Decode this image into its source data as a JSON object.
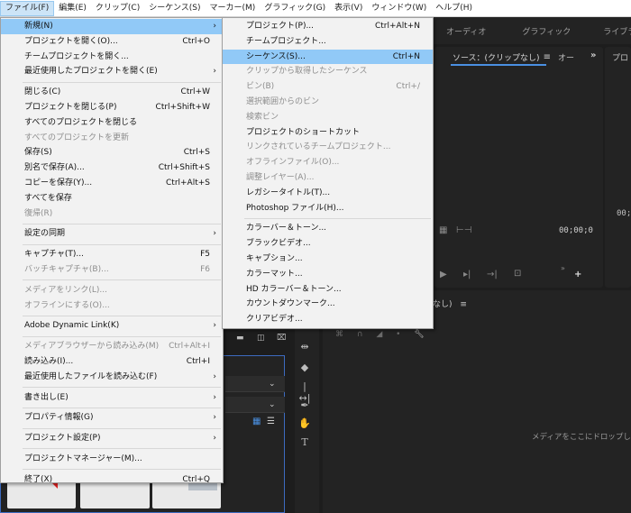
{
  "menubar": {
    "items": [
      {
        "label": "ファイル(F)",
        "active": true
      },
      {
        "label": "編集(E)"
      },
      {
        "label": "クリップ(C)"
      },
      {
        "label": "シーケンス(S)"
      },
      {
        "label": "マーカー(M)"
      },
      {
        "label": "グラフィック(G)"
      },
      {
        "label": "表示(V)"
      },
      {
        "label": "ウィンドウ(W)"
      },
      {
        "label": "ヘルプ(H)"
      }
    ]
  },
  "workspaces": {
    "audio": "オーディオ",
    "graphics": "グラフィック",
    "library": "ライブラリ"
  },
  "source_panel": {
    "title": "ソース：(クリップなし)",
    "menu_icon": "≡",
    "next_tab": "オー",
    "more": "»",
    "program_short": "プロ"
  },
  "timecodes": {
    "source": "00;00;0",
    "program": "00;"
  },
  "timeline": {
    "label": "なし)",
    "menu_icon": "≡",
    "drop_hint": "メディアをここにドロップして"
  },
  "file_menu": {
    "items": [
      {
        "label": "新規(N)",
        "arrow": "›",
        "hl": true
      },
      {
        "label": "プロジェクトを開く(O)...",
        "shortcut": "Ctrl+O"
      },
      {
        "label": "チームプロジェクトを開く..."
      },
      {
        "label": "最近使用したプロジェクトを開く(E)",
        "arrow": "›"
      },
      {
        "sep": true
      },
      {
        "label": "閉じる(C)",
        "shortcut": "Ctrl+W"
      },
      {
        "label": "プロジェクトを閉じる(P)",
        "shortcut": "Ctrl+Shift+W"
      },
      {
        "label": "すべてのプロジェクトを閉じる"
      },
      {
        "label": "すべてのプロジェクトを更新",
        "disabled": true
      },
      {
        "label": "保存(S)",
        "shortcut": "Ctrl+S"
      },
      {
        "label": "別名で保存(A)...",
        "shortcut": "Ctrl+Shift+S"
      },
      {
        "label": "コピーを保存(Y)...",
        "shortcut": "Ctrl+Alt+S"
      },
      {
        "label": "すべてを保存"
      },
      {
        "label": "復帰(R)",
        "disabled": true
      },
      {
        "sep": true
      },
      {
        "label": "設定の同期",
        "arrow": "›"
      },
      {
        "sep": true
      },
      {
        "label": "キャプチャ(T)...",
        "shortcut": "F5"
      },
      {
        "label": "バッチキャプチャ(B)...",
        "shortcut": "F6",
        "disabled": true
      },
      {
        "sep": true
      },
      {
        "label": "メディアをリンク(L)...",
        "disabled": true
      },
      {
        "label": "オフラインにする(O)...",
        "disabled": true
      },
      {
        "sep": true
      },
      {
        "label": "Adobe Dynamic Link(K)",
        "arrow": "›"
      },
      {
        "sep": true
      },
      {
        "label": "メディアブラウザーから読み込み(M)",
        "shortcut": "Ctrl+Alt+I",
        "disabled": true
      },
      {
        "label": "読み込み(I)...",
        "shortcut": "Ctrl+I"
      },
      {
        "label": "最近使用したファイルを読み込む(F)",
        "arrow": "›"
      },
      {
        "sep": true
      },
      {
        "label": "書き出し(E)",
        "arrow": "›"
      },
      {
        "sep": true
      },
      {
        "label": "プロパティ情報(G)",
        "arrow": "›"
      },
      {
        "sep": true
      },
      {
        "label": "プロジェクト設定(P)",
        "arrow": "›"
      },
      {
        "sep": true
      },
      {
        "label": "プロジェクトマネージャー(M)..."
      },
      {
        "sep": true
      },
      {
        "label": "終了(X)",
        "shortcut": "Ctrl+Q"
      }
    ]
  },
  "new_menu": {
    "items": [
      {
        "label": "プロジェクト(P)...",
        "shortcut": "Ctrl+Alt+N"
      },
      {
        "label": "チームプロジェクト..."
      },
      {
        "label": "シーケンス(S)...",
        "shortcut": "Ctrl+N",
        "hl": true
      },
      {
        "label": "クリップから取得したシーケンス",
        "disabled": true
      },
      {
        "label": "ビン(B)",
        "shortcut": "Ctrl+/",
        "disabled": true
      },
      {
        "label": "選択範囲からのビン",
        "disabled": true
      },
      {
        "label": "検索ビン",
        "disabled": true
      },
      {
        "label": "プロジェクトのショートカット"
      },
      {
        "label": "リンクされているチームプロジェクト...",
        "disabled": true
      },
      {
        "label": "オフラインファイル(O)...",
        "disabled": true
      },
      {
        "label": "調整レイヤー(A)...",
        "disabled": true
      },
      {
        "label": "レガシータイトル(T)..."
      },
      {
        "label": "Photoshop ファイル(H)..."
      },
      {
        "sep": true
      },
      {
        "label": "カラーバー＆トーン..."
      },
      {
        "label": "ブラックビデオ..."
      },
      {
        "label": "キャプション..."
      },
      {
        "label": "カラーマット..."
      },
      {
        "label": "HD カラーバー＆トーン..."
      },
      {
        "label": "カウントダウンマーク..."
      },
      {
        "label": "クリアビデオ..."
      }
    ]
  }
}
